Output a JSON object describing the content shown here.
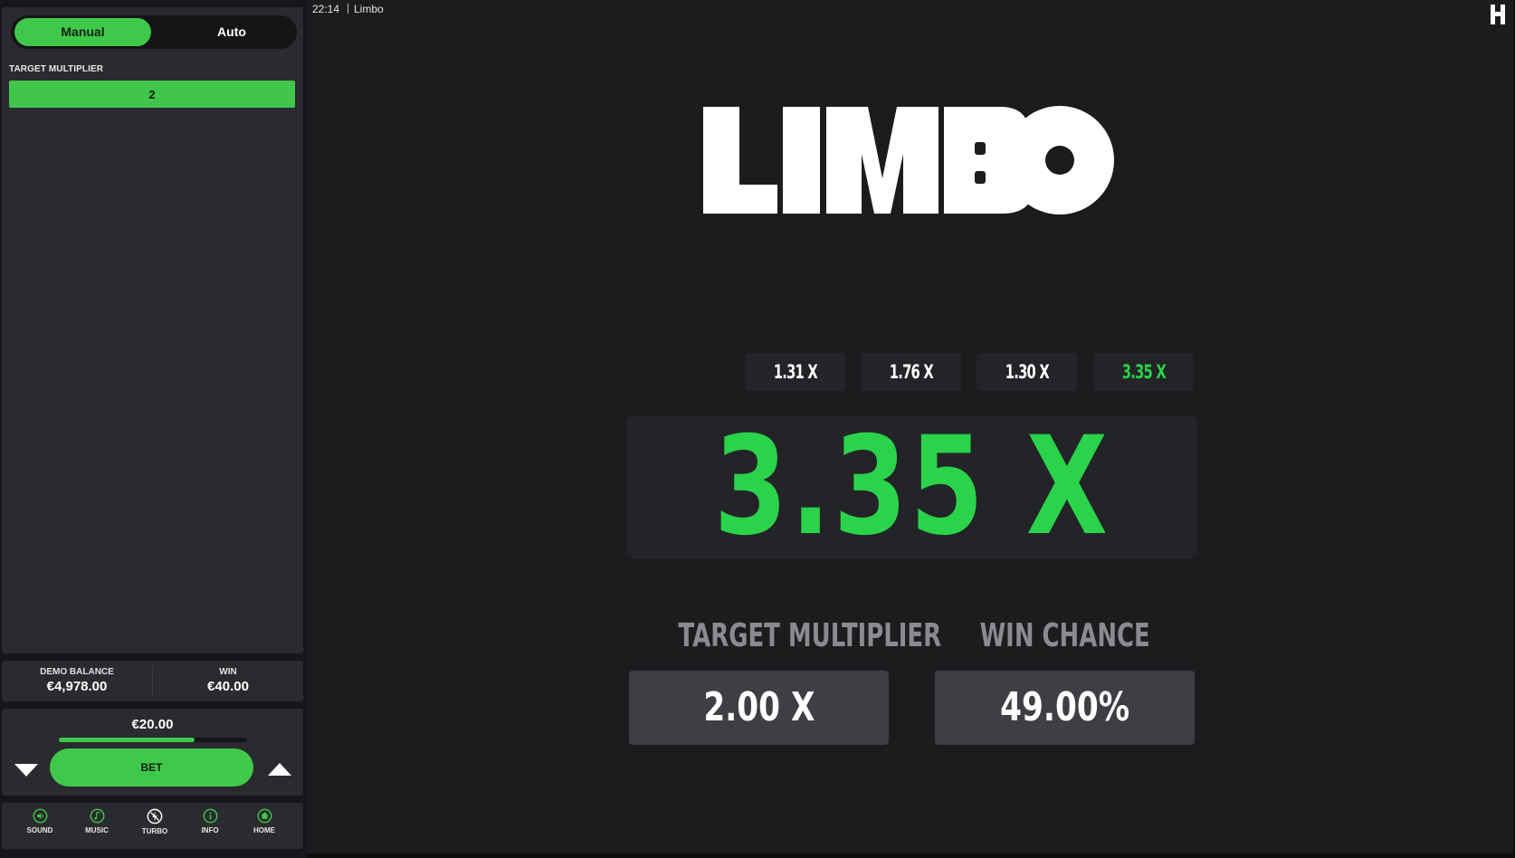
{
  "colors": {
    "accent": "#3fc94a",
    "result": "#2ad34a",
    "panel": "#2a2b2e",
    "chip": "#232427",
    "stat_box": "#3d3f44"
  },
  "topbar": {
    "time": "22:14",
    "title": "Limbo"
  },
  "sidebar": {
    "modes": {
      "manual": "Manual",
      "auto": "Auto",
      "active": "Manual"
    },
    "target_multiplier_label": "TARGET MULTIPLIER",
    "target_multiplier_value": "2",
    "balance": {
      "label": "DEMO BALANCE",
      "value": "€4,978.00"
    },
    "win": {
      "label": "WIN",
      "value": "€40.00"
    },
    "bet": {
      "amount": "€20.00",
      "slider_fraction": 0.72,
      "button_label": "BET"
    },
    "nav": [
      {
        "label": "SOUND",
        "icon": "sound-icon"
      },
      {
        "label": "MUSIC",
        "icon": "music-icon"
      },
      {
        "label": "TURBO",
        "icon": "turbo-icon"
      },
      {
        "label": "INFO",
        "icon": "info-icon"
      },
      {
        "label": "HOME",
        "icon": "home-icon"
      }
    ]
  },
  "game": {
    "logo_text": "LIMBO",
    "history": [
      {
        "value": "1.31 X",
        "highlight": false
      },
      {
        "value": "1.76 X",
        "highlight": false
      },
      {
        "value": "1.30 X",
        "highlight": false
      },
      {
        "value": "3.35 X",
        "highlight": true
      }
    ],
    "result": "3.35 X",
    "target_multiplier": {
      "label": "TARGET MULTIPLIER",
      "value": "2.00 X"
    },
    "win_chance": {
      "label": "WIN CHANCE",
      "value": "49.00%"
    }
  }
}
